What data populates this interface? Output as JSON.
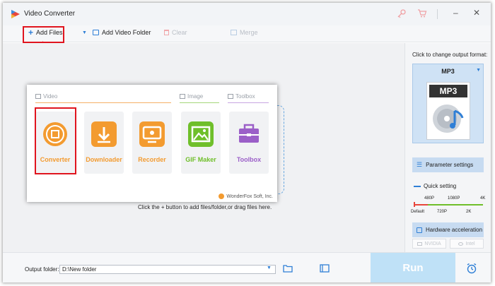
{
  "window": {
    "title": "Video Converter"
  },
  "toolbar": {
    "add_files": "Add Files",
    "add_video_folder": "Add Video Folder",
    "clear": "Clear",
    "merge": "Merge"
  },
  "popup": {
    "sections": {
      "video": "Video",
      "image": "Image",
      "toolbox": "Toolbox"
    },
    "tools": [
      {
        "label": "Converter",
        "color": "#f39b30"
      },
      {
        "label": "Downloader",
        "color": "#f39b30"
      },
      {
        "label": "Recorder",
        "color": "#f39b30"
      },
      {
        "label": "GIF Maker",
        "color": "#6fbf2a"
      },
      {
        "label": "Toolbox",
        "color": "#9b5fc8"
      }
    ],
    "brand": "WonderFox Soft, Inc."
  },
  "main": {
    "hint": "Click the + button to add files/folder,or drag files here."
  },
  "right_panel": {
    "heading": "Click to change output format:",
    "format": "MP3",
    "parameter_settings": "Parameter settings",
    "quick_setting": "Quick setting",
    "scale_top": [
      "480P",
      "1080P",
      "4K"
    ],
    "scale_bottom": [
      "Default",
      "720P",
      "2K"
    ],
    "hardware_acceleration": "Hardware acceleration",
    "gpu": [
      "NVIDIA",
      "Intel"
    ]
  },
  "bottom": {
    "output_folder_label": "Output folder:",
    "output_folder_value": "D:\\New folder",
    "run": "Run"
  },
  "colors": {
    "accent_red": "#e0141e",
    "run_bg": "#bfe1f7",
    "orange": "#f39b30"
  }
}
